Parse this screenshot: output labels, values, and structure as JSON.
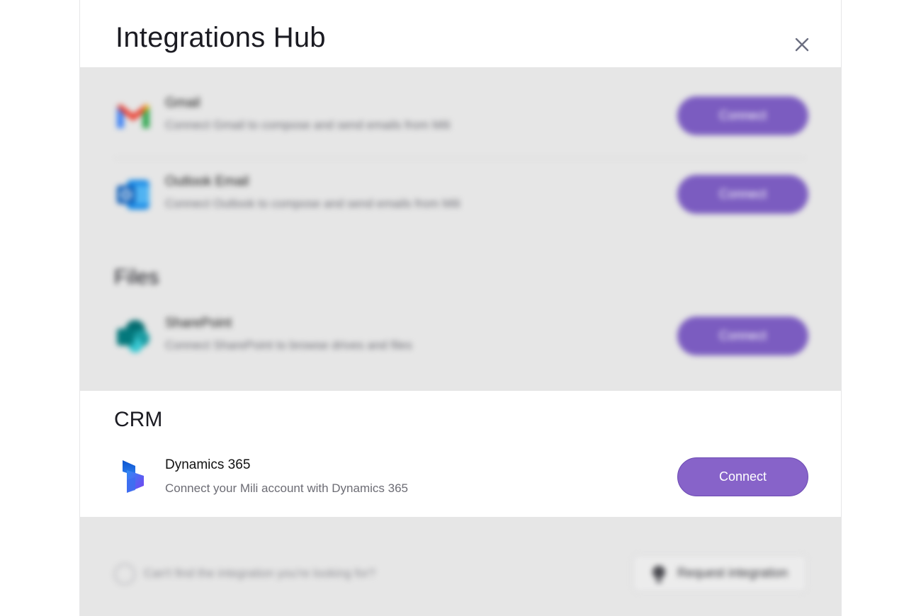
{
  "modal": {
    "title": "Integrations Hub"
  },
  "email_section": {
    "items": [
      {
        "name": "Gmail",
        "description": "Connect Gmail to compose and send emails from Mili",
        "button": "Connect",
        "icon": "gmail-icon"
      },
      {
        "name": "Outlook Email",
        "description": "Connect Outlook to compose and send emails from Mili",
        "button": "Connect",
        "icon": "outlook-icon"
      }
    ]
  },
  "files_section": {
    "title": "Files",
    "items": [
      {
        "name": "SharePoint",
        "description": "Connect SharePoint to browse drives and files",
        "button": "Connect",
        "icon": "sharepoint-icon"
      }
    ]
  },
  "crm_section": {
    "title": "CRM",
    "items": [
      {
        "name": "Dynamics 365",
        "description": "Connect your Mili account with Dynamics 365",
        "button": "Connect",
        "icon": "dynamics-365-icon"
      }
    ]
  },
  "footer": {
    "hint": "Can't find the integration you're looking for?",
    "request_button": "Request integration"
  },
  "colors": {
    "accent": "#8763c9",
    "overlay": "#e6e6e6"
  }
}
